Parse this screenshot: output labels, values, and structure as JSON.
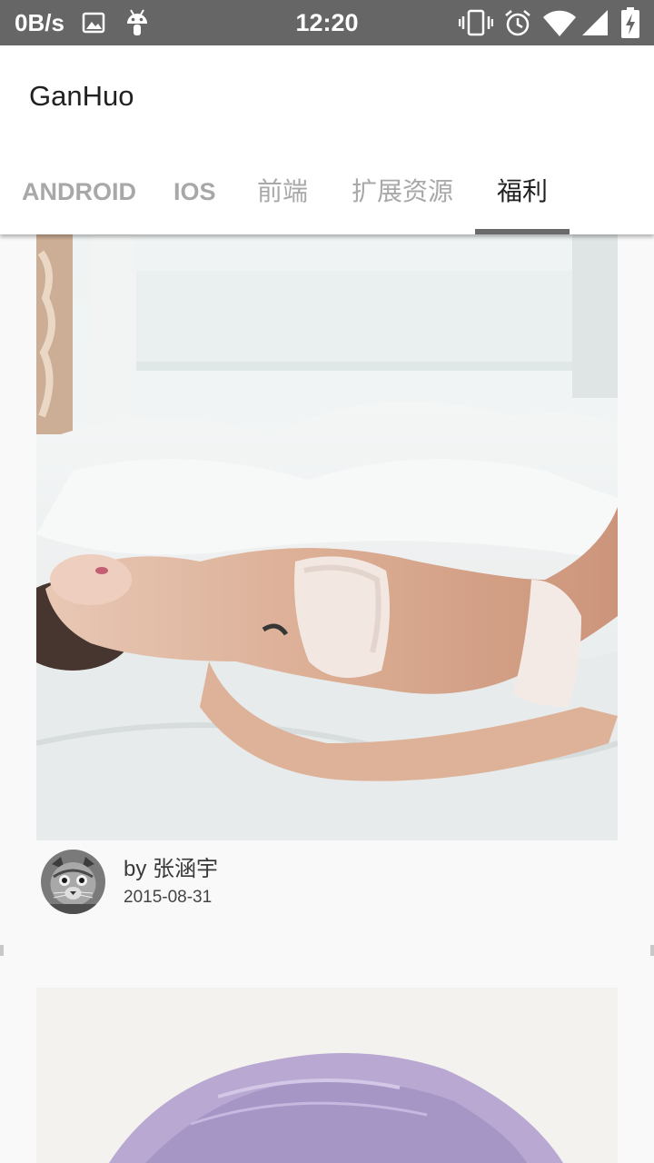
{
  "status_bar": {
    "net_speed": "0B/s",
    "time": "12:20",
    "left_icons": [
      "image-icon",
      "android-icon"
    ],
    "right_icons": [
      "vibrate-icon",
      "alarm-icon",
      "wifi-icon",
      "cell-signal-icon",
      "battery-charging-icon"
    ]
  },
  "app_bar": {
    "title": "GanHuo"
  },
  "tabs": [
    {
      "label": "ANDROID"
    },
    {
      "label": "IOS"
    },
    {
      "label": "前端"
    },
    {
      "label": "扩展资源"
    },
    {
      "label": "福利"
    }
  ],
  "active_tab": "福利",
  "feed": {
    "items": [
      {
        "author": "by 张涵宇",
        "date": "2015-08-31",
        "image": "photo-woman-on-bed"
      },
      {
        "image": "photo-lavender-hair"
      }
    ]
  },
  "colors": {
    "status_bar": "#666666",
    "app_bar": "#ffffff",
    "tab_active": "#212121",
    "tab_inactive": "#a8a8a8",
    "indicator": "#6a6a6a",
    "background": "#f9f9f9"
  }
}
